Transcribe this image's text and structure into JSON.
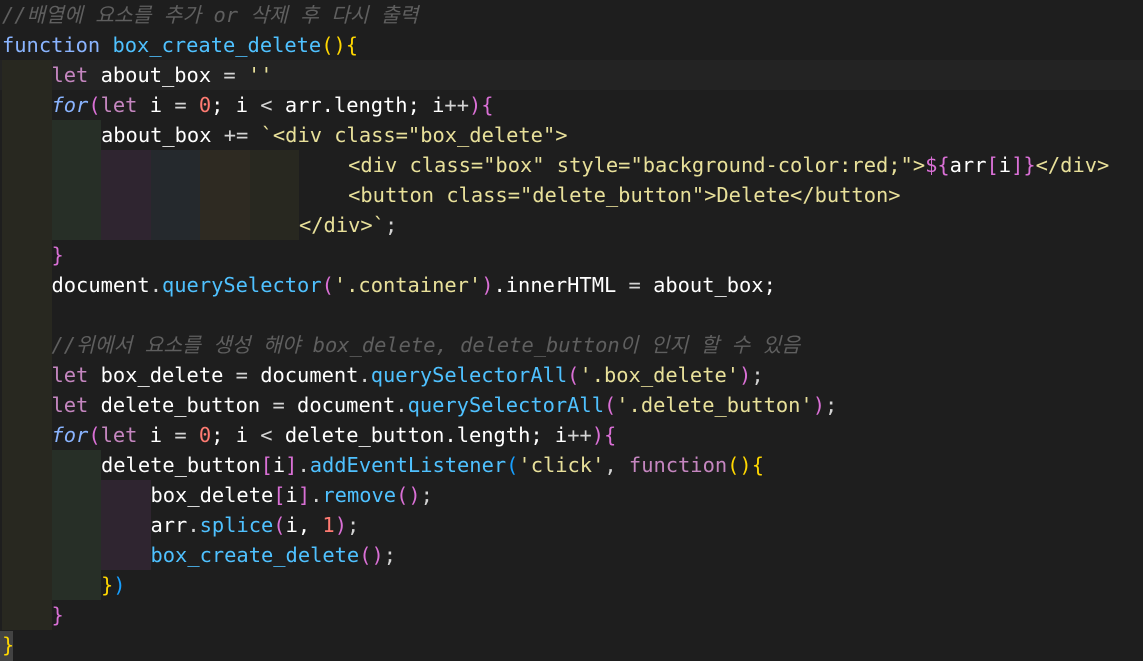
{
  "editor": {
    "language": "javascript",
    "palette": {
      "plain": "#d4d4d4",
      "variable": "#ffffff",
      "keyword": "#c586c0",
      "control": "#8ab4ff",
      "function": "#4fc1ff",
      "string": "#e8e09a",
      "template": "#e8e09a",
      "number": "#ff7b72",
      "comment": "#5f5f5f",
      "bracket_yellow": "#ffd700",
      "bracket_purple": "#da70d6",
      "bracket_blue": "#179fff"
    },
    "indent_guide_colors": [
      "#282820",
      "#272f27",
      "#2f2530",
      "#25292d",
      "#2e2a22"
    ],
    "lines": [
      {
        "guides": 0,
        "tokens": [
          {
            "t": "//배열에 요소를 추가 or 삭제 후 다시 출력",
            "c": "comment"
          }
        ]
      },
      {
        "guides": 0,
        "tokens": [
          {
            "t": "function",
            "c": "control"
          },
          {
            "t": " ",
            "c": "plain"
          },
          {
            "t": "box_create_delete",
            "c": "function"
          },
          {
            "t": "()",
            "c": "bracket_yellow"
          },
          {
            "t": "{",
            "c": "bracket_yellow"
          }
        ]
      },
      {
        "guides": 1,
        "current": true,
        "tokens": [
          {
            "t": "let",
            "c": "keyword"
          },
          {
            "t": " about_box ",
            "c": "variable"
          },
          {
            "t": "=",
            "c": "plain"
          },
          {
            "t": " ",
            "c": "plain"
          },
          {
            "t": "''",
            "c": "string"
          }
        ]
      },
      {
        "guides": 1,
        "tokens": [
          {
            "t": "for",
            "c": "control",
            "i": true
          },
          {
            "t": "(",
            "c": "bracket_purple"
          },
          {
            "t": "let",
            "c": "keyword"
          },
          {
            "t": " i ",
            "c": "variable"
          },
          {
            "t": "=",
            "c": "plain"
          },
          {
            "t": " ",
            "c": "plain"
          },
          {
            "t": "0",
            "c": "number"
          },
          {
            "t": "; i ",
            "c": "variable"
          },
          {
            "t": "<",
            "c": "plain"
          },
          {
            "t": " arr.length; i",
            "c": "variable"
          },
          {
            "t": "++",
            "c": "plain"
          },
          {
            "t": ")",
            "c": "bracket_purple"
          },
          {
            "t": "{",
            "c": "bracket_purple"
          }
        ]
      },
      {
        "guides": 2,
        "tokens": [
          {
            "t": "about_box ",
            "c": "variable"
          },
          {
            "t": "+=",
            "c": "plain"
          },
          {
            "t": " ",
            "c": "plain"
          },
          {
            "t": "`<div class=\"box_delete\">",
            "c": "template"
          }
        ]
      },
      {
        "guides": 6,
        "tokens": [
          {
            "t": "    ",
            "c": "plain"
          },
          {
            "t": "<div class=\"box\" style=\"background-color:red;\">",
            "c": "template"
          },
          {
            "t": "${",
            "c": "bracket_purple"
          },
          {
            "t": "arr",
            "c": "variable"
          },
          {
            "t": "[",
            "c": "bracket_purple"
          },
          {
            "t": "i",
            "c": "variable"
          },
          {
            "t": "]",
            "c": "bracket_purple"
          },
          {
            "t": "}",
            "c": "bracket_purple"
          },
          {
            "t": "</div>",
            "c": "template"
          }
        ]
      },
      {
        "guides": 6,
        "tokens": [
          {
            "t": "    ",
            "c": "plain"
          },
          {
            "t": "<button class=\"delete_button\">Delete</button>",
            "c": "template"
          }
        ]
      },
      {
        "guides": 6,
        "tokens": [
          {
            "t": "</div>`",
            "c": "template"
          },
          {
            "t": ";",
            "c": "plain"
          }
        ]
      },
      {
        "guides": 1,
        "tokens": [
          {
            "t": "}",
            "c": "bracket_purple"
          }
        ]
      },
      {
        "guides": 1,
        "tokens": [
          {
            "t": "document",
            "c": "variable"
          },
          {
            "t": ".",
            "c": "plain"
          },
          {
            "t": "querySelector",
            "c": "function"
          },
          {
            "t": "(",
            "c": "bracket_purple"
          },
          {
            "t": "'.container'",
            "c": "string"
          },
          {
            "t": ")",
            "c": "bracket_purple"
          },
          {
            "t": ".innerHTML ",
            "c": "variable"
          },
          {
            "t": "=",
            "c": "plain"
          },
          {
            "t": " about_box;",
            "c": "variable"
          }
        ]
      },
      {
        "guides": 1,
        "tokens": []
      },
      {
        "guides": 1,
        "tokens": [
          {
            "t": "//위에서 요소를 생성 해야 box_delete, delete_button이 인지 할 수 있음",
            "c": "comment"
          }
        ]
      },
      {
        "guides": 1,
        "tokens": [
          {
            "t": "let",
            "c": "keyword"
          },
          {
            "t": " box_delete ",
            "c": "variable"
          },
          {
            "t": "=",
            "c": "plain"
          },
          {
            "t": " document",
            "c": "variable"
          },
          {
            "t": ".",
            "c": "plain"
          },
          {
            "t": "querySelectorAll",
            "c": "function"
          },
          {
            "t": "(",
            "c": "bracket_purple"
          },
          {
            "t": "'.box_delete'",
            "c": "string"
          },
          {
            "t": ")",
            "c": "bracket_purple"
          },
          {
            "t": ";",
            "c": "plain"
          }
        ]
      },
      {
        "guides": 1,
        "tokens": [
          {
            "t": "let",
            "c": "keyword"
          },
          {
            "t": " delete_button ",
            "c": "variable"
          },
          {
            "t": "=",
            "c": "plain"
          },
          {
            "t": " document",
            "c": "variable"
          },
          {
            "t": ".",
            "c": "plain"
          },
          {
            "t": "querySelectorAll",
            "c": "function"
          },
          {
            "t": "(",
            "c": "bracket_purple"
          },
          {
            "t": "'.delete_button'",
            "c": "string"
          },
          {
            "t": ")",
            "c": "bracket_purple"
          },
          {
            "t": ";",
            "c": "plain"
          }
        ]
      },
      {
        "guides": 1,
        "tokens": [
          {
            "t": "for",
            "c": "control",
            "i": true
          },
          {
            "t": "(",
            "c": "bracket_purple"
          },
          {
            "t": "let",
            "c": "keyword"
          },
          {
            "t": " i ",
            "c": "variable"
          },
          {
            "t": "=",
            "c": "plain"
          },
          {
            "t": " ",
            "c": "plain"
          },
          {
            "t": "0",
            "c": "number"
          },
          {
            "t": "; i ",
            "c": "variable"
          },
          {
            "t": "<",
            "c": "plain"
          },
          {
            "t": " delete_button.length; i",
            "c": "variable"
          },
          {
            "t": "++",
            "c": "plain"
          },
          {
            "t": ")",
            "c": "bracket_purple"
          },
          {
            "t": "{",
            "c": "bracket_purple"
          }
        ]
      },
      {
        "guides": 2,
        "tokens": [
          {
            "t": "delete_button",
            "c": "variable"
          },
          {
            "t": "[",
            "c": "bracket_purple"
          },
          {
            "t": "i",
            "c": "variable"
          },
          {
            "t": "]",
            "c": "bracket_purple"
          },
          {
            "t": ".",
            "c": "plain"
          },
          {
            "t": "addEventListener",
            "c": "function"
          },
          {
            "t": "(",
            "c": "bracket_blue"
          },
          {
            "t": "'click'",
            "c": "string"
          },
          {
            "t": ", ",
            "c": "plain"
          },
          {
            "t": "function",
            "c": "keyword"
          },
          {
            "t": "()",
            "c": "bracket_yellow"
          },
          {
            "t": "{",
            "c": "bracket_yellow"
          }
        ]
      },
      {
        "guides": 3,
        "tokens": [
          {
            "t": "box_delete",
            "c": "variable"
          },
          {
            "t": "[",
            "c": "bracket_purple"
          },
          {
            "t": "i",
            "c": "variable"
          },
          {
            "t": "]",
            "c": "bracket_purple"
          },
          {
            "t": ".",
            "c": "plain"
          },
          {
            "t": "remove",
            "c": "function"
          },
          {
            "t": "()",
            "c": "bracket_purple"
          },
          {
            "t": ";",
            "c": "plain"
          }
        ]
      },
      {
        "guides": 3,
        "tokens": [
          {
            "t": "arr",
            "c": "variable"
          },
          {
            "t": ".",
            "c": "plain"
          },
          {
            "t": "splice",
            "c": "function"
          },
          {
            "t": "(",
            "c": "bracket_purple"
          },
          {
            "t": "i, ",
            "c": "variable"
          },
          {
            "t": "1",
            "c": "number"
          },
          {
            "t": ")",
            "c": "bracket_purple"
          },
          {
            "t": ";",
            "c": "plain"
          }
        ]
      },
      {
        "guides": 3,
        "tokens": [
          {
            "t": "box_create_delete",
            "c": "function"
          },
          {
            "t": "()",
            "c": "bracket_purple"
          },
          {
            "t": ";",
            "c": "plain"
          }
        ]
      },
      {
        "guides": 2,
        "tokens": [
          {
            "t": "}",
            "c": "bracket_yellow"
          },
          {
            "t": ")",
            "c": "bracket_blue"
          }
        ]
      },
      {
        "guides": 1,
        "tokens": [
          {
            "t": "}",
            "c": "bracket_purple"
          }
        ]
      },
      {
        "guides": 0,
        "tokens": [
          {
            "t": "}",
            "c": "bracket_yellow"
          }
        ]
      }
    ]
  }
}
